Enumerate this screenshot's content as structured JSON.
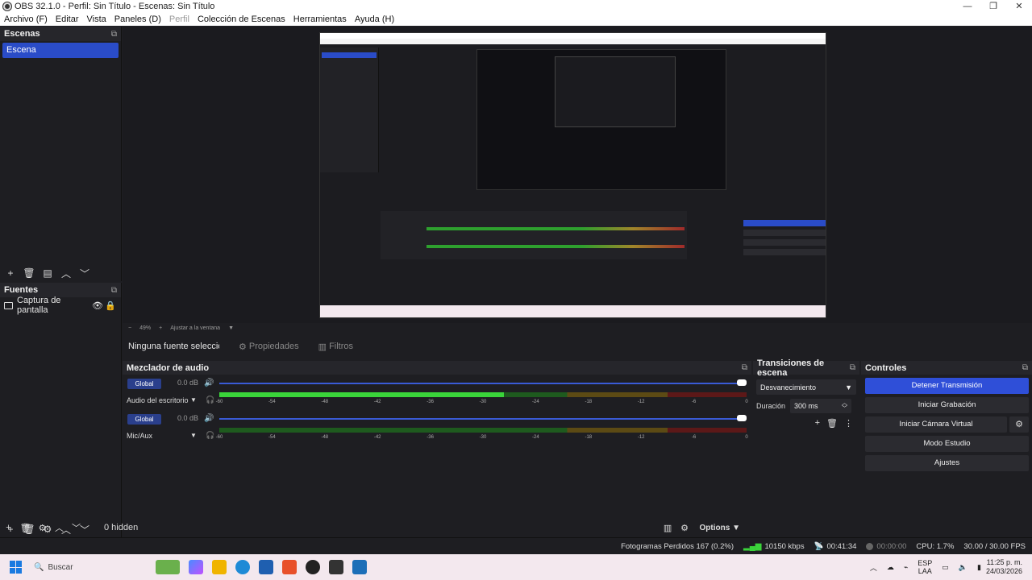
{
  "window": {
    "title": "OBS 32.1.0 - Perfil: Sin Título - Escenas: Sin Título",
    "controls": [
      "—",
      "❐",
      "✕"
    ]
  },
  "menu": [
    "Archivo (F)",
    "Editar",
    "Vista",
    "Paneles (D)",
    "Perfil",
    "Colección de Escenas",
    "Herramientas",
    "Ayuda (H)"
  ],
  "scenes": {
    "title": "Escenas",
    "items": [
      "Escena"
    ]
  },
  "sources": {
    "title": "Fuentes",
    "items": [
      "Captura de pantalla"
    ]
  },
  "preview": {
    "zoom": "49%",
    "fit_label": "Ajustar a la ventana"
  },
  "properties_bar": {
    "no_source": "Ninguna fuente seleccionad",
    "properties": "Propiedades",
    "filters": "Filtros"
  },
  "mixer": {
    "title": "Mezclador de audio",
    "channels": [
      {
        "badge": "Global",
        "db": "0.0 dB",
        "name": "Audio del escritorio",
        "level": 0.54
      },
      {
        "badge": "Global",
        "db": "0.0 dB",
        "name": "Mic/Aux",
        "level": 0.0
      }
    ],
    "scale": [
      "-60",
      "-54",
      "-48",
      "-42",
      "-36",
      "-30",
      "-24",
      "-18",
      "-12",
      "-6",
      "0"
    ],
    "hidden": "0 hidden",
    "options": "Options"
  },
  "transitions": {
    "title": "Transiciones de escena",
    "selected": "Desvanecimiento",
    "duration_label": "Duración",
    "duration_value": "300 ms"
  },
  "controls": {
    "title": "Controles",
    "stop_stream": "Detener Transmisión",
    "start_recording": "Iniciar Grabación",
    "start_virtual_cam": "Iniciar Cámara Virtual",
    "studio_mode": "Modo Estudio",
    "settings": "Ajustes"
  },
  "status": {
    "dropped_frames": "Fotogramas Perdidos 167 (0.2%)",
    "bitrate": "10150 kbps",
    "stream_time": "00:41:34",
    "rec_time": "00:00:00",
    "cpu": "CPU: 1.7%",
    "fps": "30.00 / 30.00 FPS"
  },
  "taskbar": {
    "search_placeholder": "Buscar",
    "lang_top": "ESP",
    "lang_bottom": "LAA",
    "time": "11:25 p. m.",
    "date": "24/03/2026"
  },
  "colors": {
    "accent": "#2f4fd8",
    "meter_green": "#3ad43a",
    "meter_yellow": "#a0862a",
    "meter_red": "#a02a2a"
  }
}
